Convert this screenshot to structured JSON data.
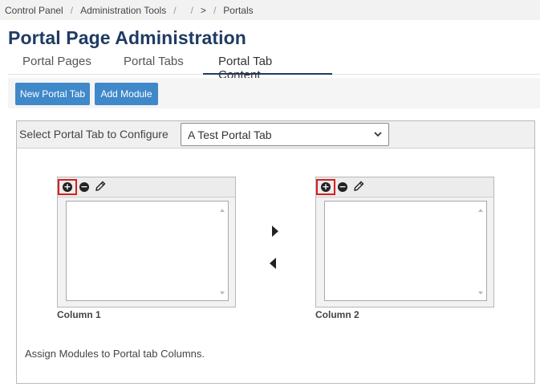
{
  "breadcrumb": {
    "items": [
      "Control Panel",
      "Administration Tools",
      "",
      ">",
      "Portals"
    ],
    "separator": "/"
  },
  "page_title": "Portal Page Administration",
  "tabs": [
    {
      "label": "Portal Pages",
      "active": false
    },
    {
      "label": "Portal Tabs",
      "active": false
    },
    {
      "label": "Portal Tab Content",
      "active": true
    }
  ],
  "toolbar": {
    "new_portal_tab": "New Portal Tab",
    "add_module": "Add Module"
  },
  "config": {
    "select_label": "Select Portal Tab to Configure",
    "selected_tab": "A Test Portal Tab"
  },
  "columns": [
    {
      "label": "Column 1"
    },
    {
      "label": "Column 2"
    }
  ],
  "hint": "Assign Modules to Portal tab Columns.",
  "colors": {
    "accent": "#3f88c9",
    "title": "#1f3b63",
    "highlight_box": "#d62020"
  }
}
